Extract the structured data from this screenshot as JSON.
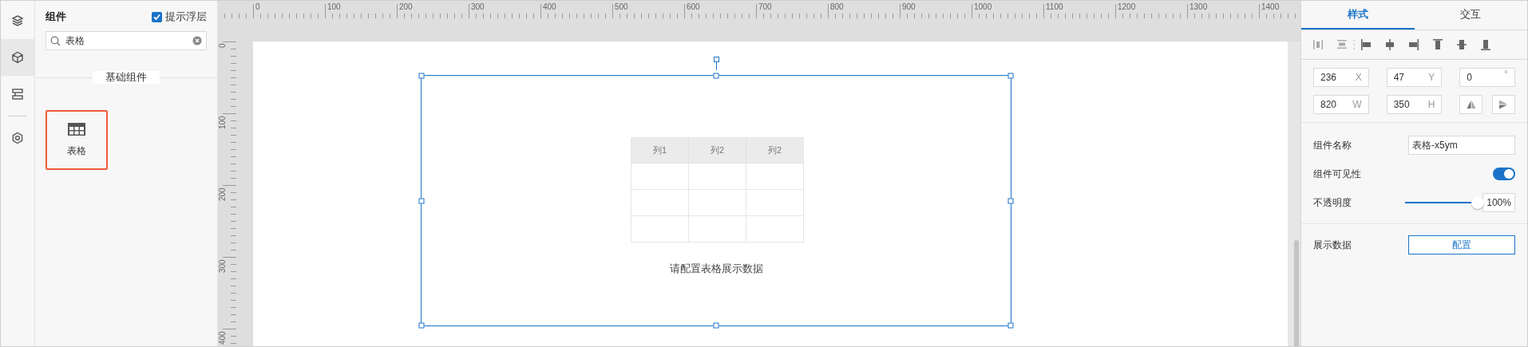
{
  "icon_bar": [
    {
      "kind": "layers",
      "selected": false
    },
    {
      "kind": "cube",
      "selected": true
    },
    {
      "kind": "layout",
      "selected": false
    },
    {
      "kind": "settings",
      "selected": false
    }
  ],
  "components_panel": {
    "title": "组件",
    "hint_checkbox": {
      "label": "提示浮层",
      "checked": true
    },
    "search": {
      "value": "表格"
    },
    "section_title": "基础组件",
    "items": [
      {
        "label": "表格",
        "selected": true
      }
    ]
  },
  "rulers": {
    "top_labels": [
      "0",
      "100",
      "200",
      "300",
      "400",
      "500",
      "600",
      "700",
      "800",
      "900",
      "1000",
      "1100",
      "1200",
      "1300",
      "1400"
    ],
    "left_labels": [
      "0",
      "100",
      "200",
      "300",
      "400"
    ]
  },
  "canvas": {
    "table": {
      "columns": [
        "列1",
        "列2",
        "列2"
      ]
    },
    "message": "请配置表格展示数据"
  },
  "properties": {
    "tabs": [
      {
        "label": "样式",
        "selected": true
      },
      {
        "label": "交互",
        "selected": false
      }
    ],
    "geometry": [
      {
        "value": "236",
        "unit": "X"
      },
      {
        "value": "47",
        "unit": "Y"
      },
      {
        "value": "0",
        "unit": "°"
      },
      {
        "value": "820",
        "unit": "W"
      },
      {
        "value": "350",
        "unit": "H"
      }
    ],
    "name": {
      "label": "组件名称",
      "value": "表格-x5ym"
    },
    "visibility": {
      "label": "组件可见性",
      "on": true
    },
    "opacity": {
      "label": "不透明度",
      "level": 1,
      "reading": "100%"
    },
    "data": {
      "label": "展示数据",
      "button": "配置"
    }
  }
}
